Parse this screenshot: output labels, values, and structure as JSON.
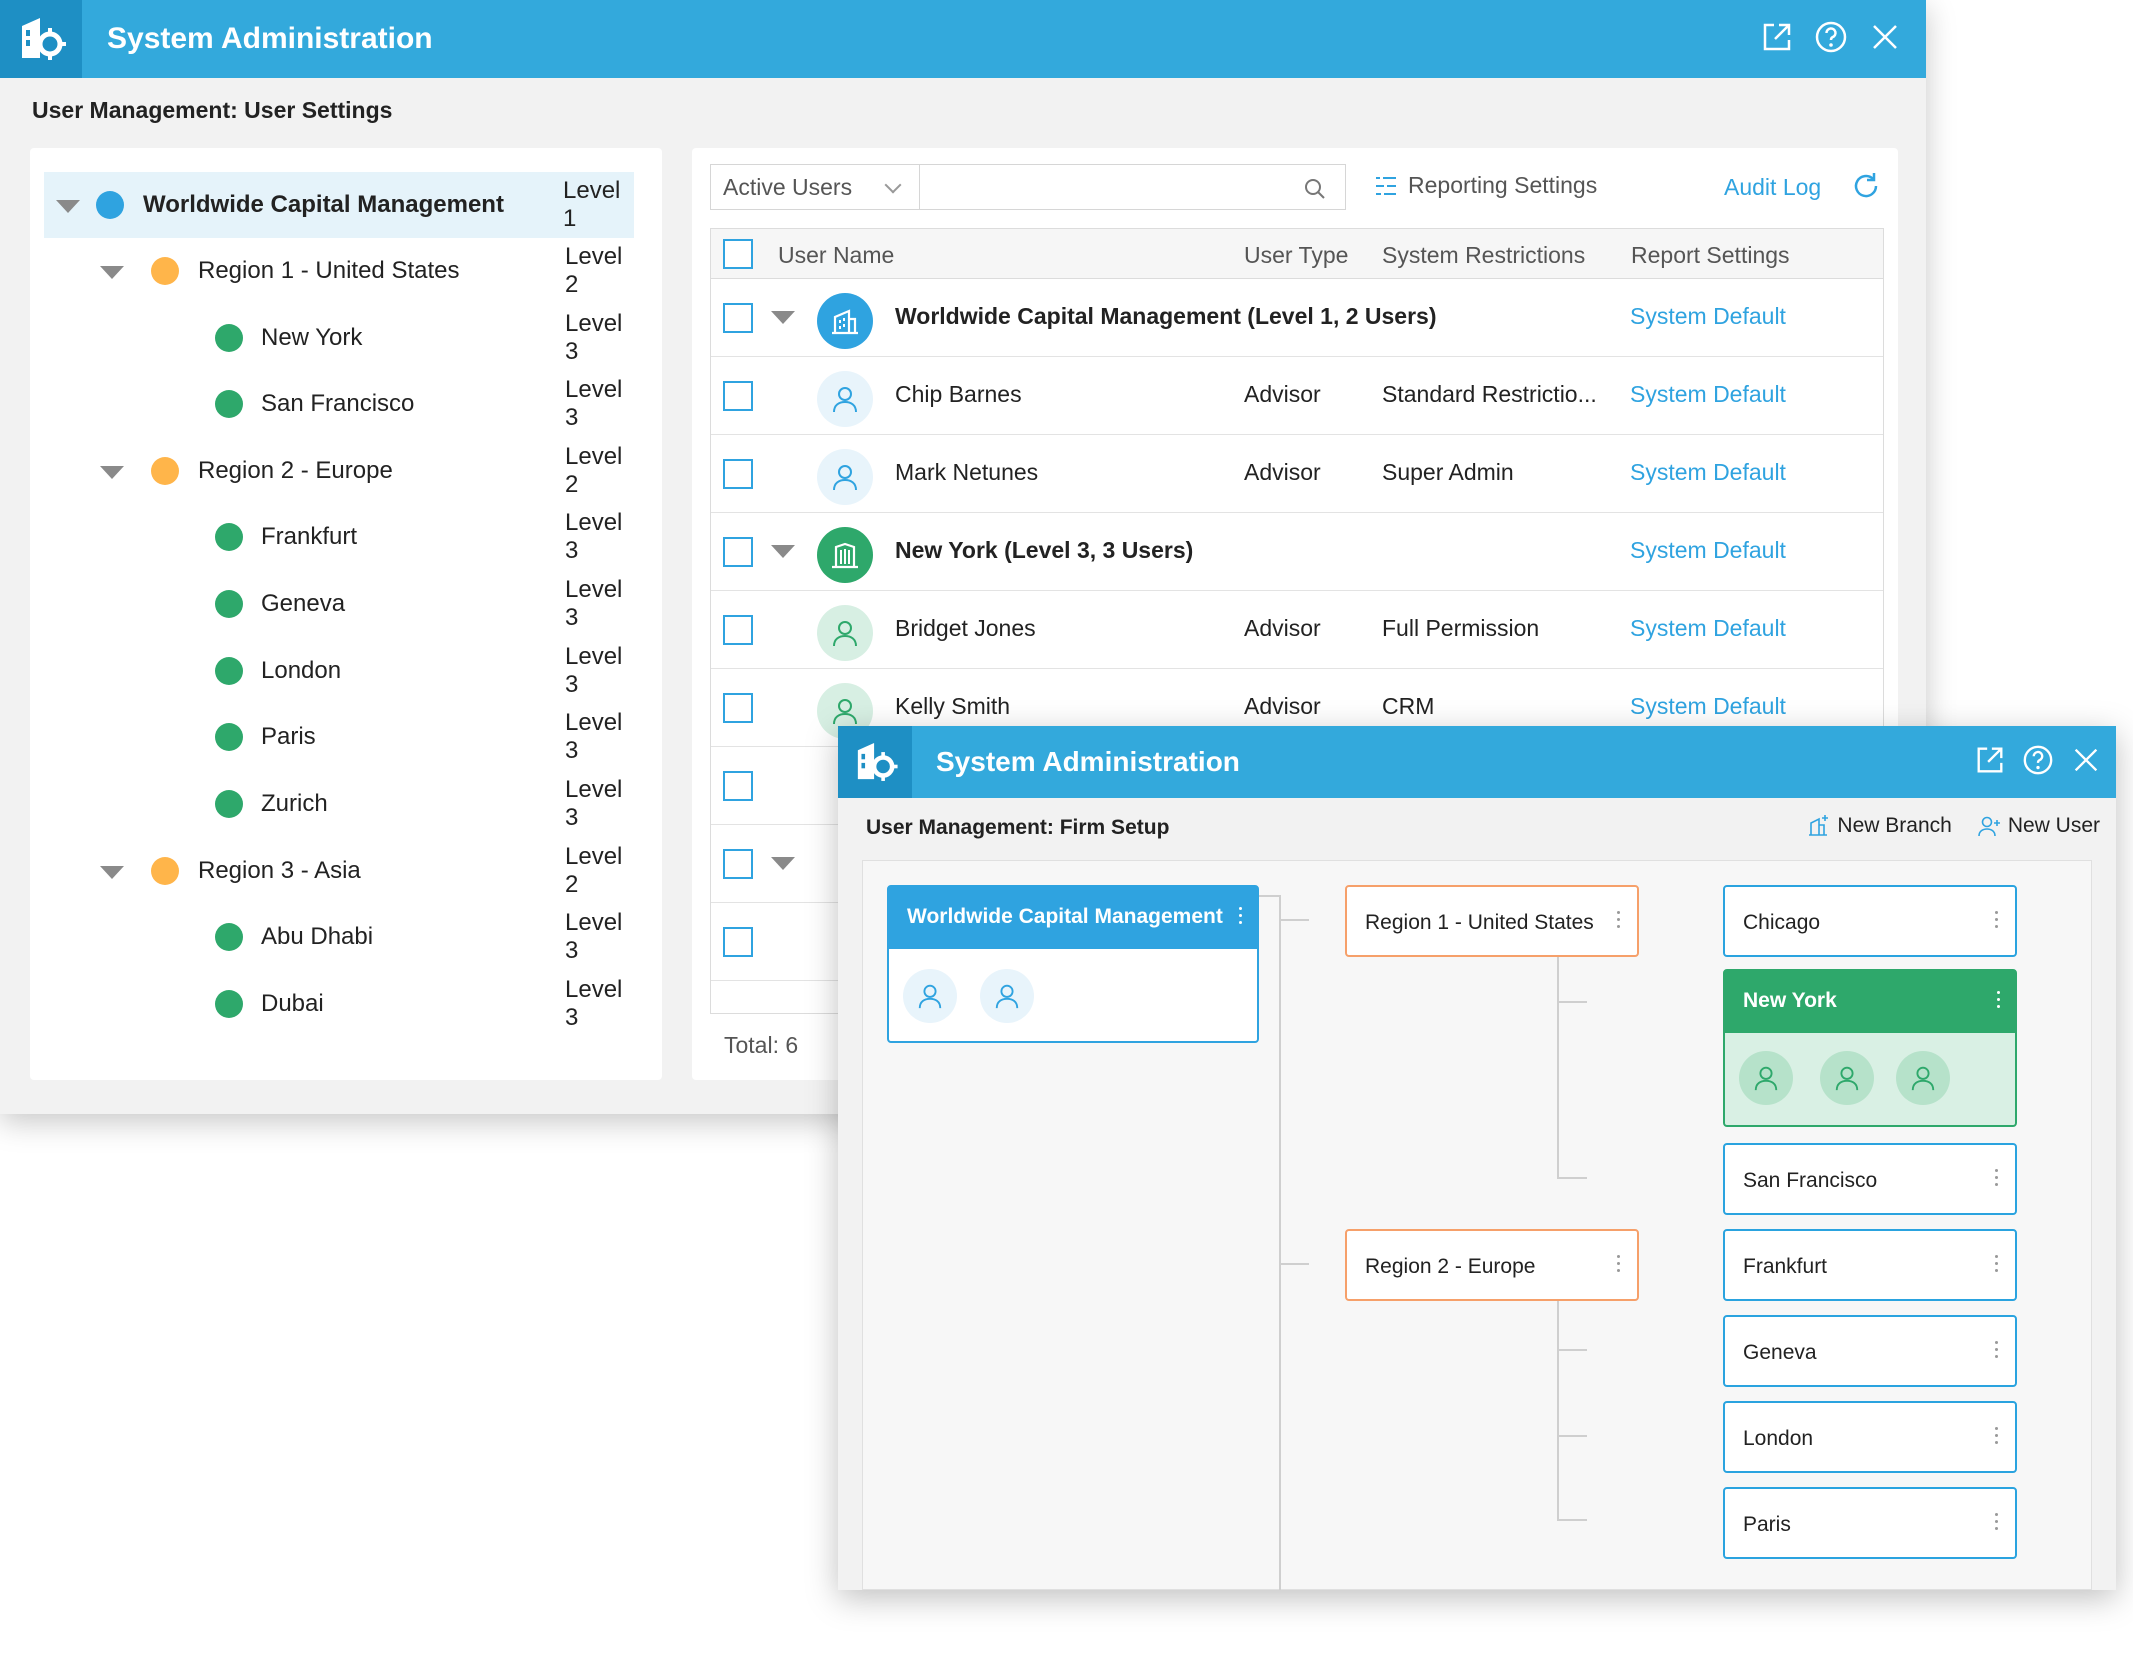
{
  "colors": {
    "header_blue": "#33a9dc",
    "accent_blue": "#2fa3e0",
    "green": "#2ea86b",
    "orange": "#ffb54a",
    "region_border": "#f6a06a"
  },
  "window1": {
    "title": "System Administration",
    "subtitle": "User Management: User Settings",
    "icons": [
      "popout-icon",
      "help-icon",
      "close-icon"
    ],
    "tree": [
      {
        "name": "Worldwide Capital Management",
        "level": "Level 1",
        "dot": "blue",
        "expanded": true
      },
      {
        "name": "Region 1 - United States",
        "level": "Level 2",
        "dot": "orange",
        "expanded": true
      },
      {
        "name": "New York",
        "level": "Level 3",
        "dot": "green"
      },
      {
        "name": "San Francisco",
        "level": "Level 3",
        "dot": "green"
      },
      {
        "name": "Region 2 - Europe",
        "level": "Level 2",
        "dot": "orange",
        "expanded": true
      },
      {
        "name": "Frankfurt",
        "level": "Level 3",
        "dot": "green"
      },
      {
        "name": "Geneva",
        "level": "Level 3",
        "dot": "green"
      },
      {
        "name": "London",
        "level": "Level 3",
        "dot": "green"
      },
      {
        "name": "Paris",
        "level": "Level 3",
        "dot": "green"
      },
      {
        "name": "Zurich",
        "level": "Level 3",
        "dot": "green"
      },
      {
        "name": "Region 3 - Asia",
        "level": "Level 2",
        "dot": "orange",
        "expanded": true
      },
      {
        "name": "Abu Dhabi",
        "level": "Level 3",
        "dot": "green"
      },
      {
        "name": "Dubai",
        "level": "Level 3",
        "dot": "green"
      }
    ],
    "toolbar": {
      "filter_value": "Active Users",
      "search_value": "",
      "reporting_settings": "Reporting Settings",
      "audit_log": "Audit Log"
    },
    "columns": [
      "User Name",
      "User Type",
      "System Restrictions",
      "Report Settings"
    ],
    "rows": [
      {
        "kind": "group",
        "name": "Worldwide Capital Management (Level 1, 2 Users)",
        "type": "",
        "restrictions": "",
        "report": "System Default",
        "avatar": "building-blue"
      },
      {
        "kind": "user",
        "name": "Chip Barnes",
        "type": "Advisor",
        "restrictions": "Standard Restrictio...",
        "report": "System Default",
        "avatar": "user-blue"
      },
      {
        "kind": "user",
        "name": "Mark Netunes",
        "type": "Advisor",
        "restrictions": "Super Admin",
        "report": "System Default",
        "avatar": "user-blue"
      },
      {
        "kind": "group",
        "name": "New York (Level 3, 3 Users)",
        "type": "",
        "restrictions": "",
        "report": "System Default",
        "avatar": "building-green"
      },
      {
        "kind": "user",
        "name": "Bridget Jones",
        "type": "Advisor",
        "restrictions": "Full Permission",
        "report": "System Default",
        "avatar": "user-green"
      },
      {
        "kind": "user",
        "name": "Kelly Smith",
        "type": "Advisor",
        "restrictions": "CRM",
        "report": "System Default",
        "avatar": "user-green"
      }
    ],
    "total_label": "Total:",
    "total_value": "6"
  },
  "window2": {
    "title": "System Administration",
    "subtitle": "User Management: Firm Setup",
    "new_branch": "New Branch",
    "new_user": "New User",
    "root": "Worldwide Capital Management",
    "regions": [
      "Region 1 - United States",
      "Region 2 - Europe"
    ],
    "branches": [
      "Chicago",
      "New York",
      "San Francisco",
      "Frankfurt",
      "Geneva",
      "London",
      "Paris"
    ]
  }
}
